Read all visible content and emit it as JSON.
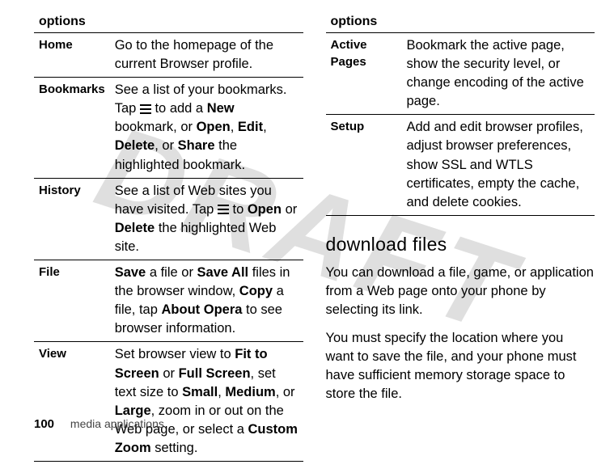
{
  "watermark": "DRAFT",
  "left_table": {
    "header": "options",
    "rows": [
      {
        "label": "Home",
        "desc_parts": [
          "Go to the homepage of the current Browser profile."
        ]
      },
      {
        "label": "Bookmarks",
        "desc_parts": [
          "See a list of your bookmarks. Tap ",
          "ICON_MENU",
          " to add a ",
          "B:New",
          " bookmark, or ",
          "B:Open",
          ", ",
          "B:Edit",
          ", ",
          "B:Delete",
          ", or ",
          "B:Share",
          " the highlighted bookmark."
        ]
      },
      {
        "label": "History",
        "desc_parts": [
          "See a list of Web sites you have visited. Tap ",
          "ICON_MENU",
          " to ",
          "B:Open",
          " or ",
          "B:Delete",
          " the highlighted Web site."
        ]
      },
      {
        "label": "File",
        "desc_parts": [
          "B:Save",
          " a file or ",
          "B:Save All",
          " files in the browser window, ",
          "B:Copy",
          " a file, tap ",
          "B:About Opera",
          " to see browser information."
        ]
      },
      {
        "label": "View",
        "desc_parts": [
          "Set browser view to ",
          "B:Fit to Screen",
          " or ",
          "B:Full Screen",
          ", set text size to ",
          "B:Small",
          ", ",
          "B:Medium",
          ", or ",
          "B:Large",
          ", zoom in or out on the Web page, or select a ",
          "B:Custom Zoom",
          " setting."
        ]
      }
    ]
  },
  "right_table": {
    "header": "options",
    "rows": [
      {
        "label": "Active Pages",
        "desc_parts": [
          "Bookmark the active page, show the security level, or change encoding of the active page."
        ]
      },
      {
        "label": "Setup",
        "desc_parts": [
          "Add and edit browser profiles, adjust browser preferences, show SSL and WTLS certificates, empty the cache, and delete cookies."
        ]
      }
    ]
  },
  "section_heading": "download files",
  "para1": "You can download a file, game, or application from a Web page onto your phone by selecting its link.",
  "para2": "You must specify the location where you want to save the file, and your phone must have sufficient memory storage space to store the file.",
  "footer": {
    "pagenum": "100",
    "chapter": "media applications"
  }
}
